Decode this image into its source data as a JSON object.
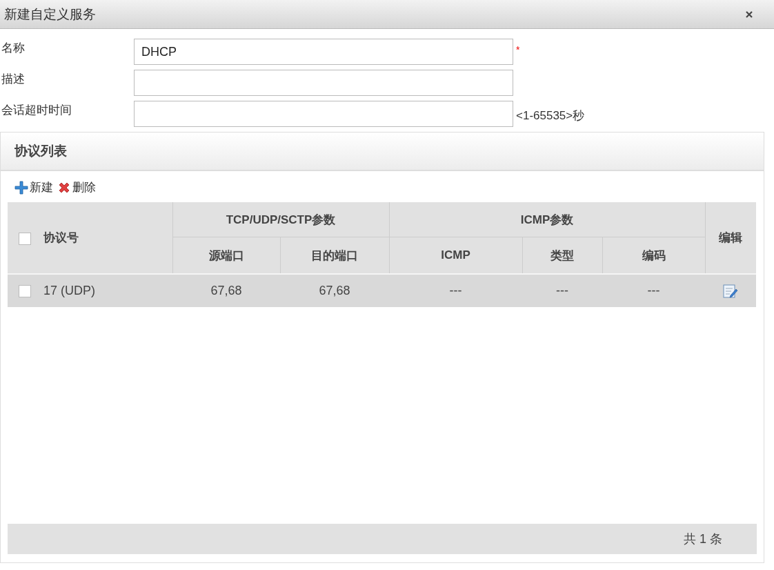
{
  "window": {
    "title": "新建自定义服务"
  },
  "fields": [
    {
      "label": "名称",
      "value": "DHCP",
      "required_mark": "*"
    },
    {
      "label": "描述"
    },
    {
      "label": "会话超时时间",
      "hint": "<1-65535>秒"
    }
  ],
  "panel": {
    "title": "协议列表",
    "toolbar": [
      {
        "kind": "add",
        "label": "新建"
      },
      {
        "kind": "delete",
        "label": "删除"
      }
    ]
  },
  "table": {
    "select_all_checked": false,
    "header_groups": [
      {
        "label": "协议号",
        "kind": "single"
      },
      {
        "label": "TCP/UDP/SCTP参数",
        "kind": "group",
        "children": [
          "源端口",
          "目的端口"
        ]
      },
      {
        "label": "ICMP参数",
        "kind": "group",
        "children": [
          "ICMP",
          "类型",
          "编码"
        ]
      },
      {
        "label": "编辑",
        "kind": "single"
      }
    ],
    "rows": [
      {
        "checked": false,
        "cells": [
          "17 (UDP)",
          "67,68",
          "67,68",
          "---",
          "---",
          "---"
        ]
      }
    ]
  },
  "footer": {
    "count": "共 1 条"
  }
}
